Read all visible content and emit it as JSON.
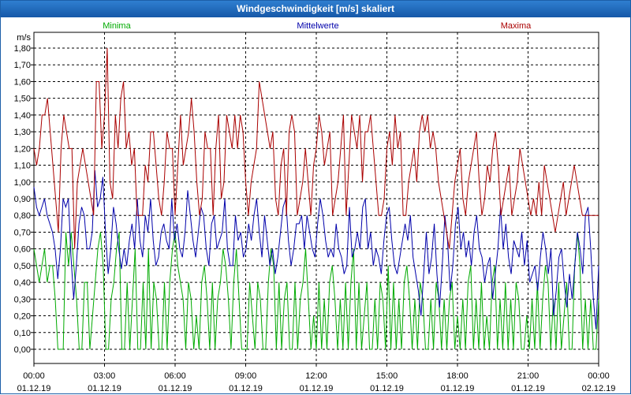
{
  "window": {
    "title": "Windgeschwindigkeit [m/s] skaliert"
  },
  "chart_data": {
    "type": "line",
    "title": "Windgeschwindigkeit [m/s] skaliert",
    "ylabel": "m/s",
    "ylim": [
      0,
      1.8
    ],
    "y_ticks": [
      "0,00",
      "0,10",
      "0,20",
      "0,30",
      "0,40",
      "0,50",
      "0,60",
      "0,70",
      "0,80",
      "0,90",
      "1,00",
      "1,10",
      "1,20",
      "1,30",
      "1,40",
      "1,50",
      "1,60",
      "1,70",
      "1,80"
    ],
    "x_ticks": [
      {
        "time": "00:00",
        "date": "01.12.19"
      },
      {
        "time": "03:00",
        "date": "01.12.19"
      },
      {
        "time": "06:00",
        "date": "01.12.19"
      },
      {
        "time": "09:00",
        "date": "01.12.19"
      },
      {
        "time": "12:00",
        "date": "01.12.19"
      },
      {
        "time": "15:00",
        "date": "01.12.19"
      },
      {
        "time": "18:00",
        "date": "01.12.19"
      },
      {
        "time": "21:00",
        "date": "01.12.19"
      },
      {
        "time": "00:00",
        "date": "02.12.19"
      }
    ],
    "grid": true,
    "legend_position": "top",
    "x_range_hours": [
      0,
      24
    ],
    "series": [
      {
        "name": "Minima",
        "color": "#00aa00",
        "values": [
          0.6,
          0.5,
          0.4,
          0.5,
          0.6,
          0.4,
          0.5,
          0.5,
          0.3,
          0.0,
          0.0,
          0.0,
          0.7,
          0.5,
          0.7,
          0.5,
          0.3,
          0.0,
          0.0,
          0.4,
          0.4,
          0.0,
          0.2,
          0.4,
          0.6,
          0.7,
          0.5,
          0.0,
          0.0,
          0.3,
          0.4,
          0.6,
          0.7,
          0.0,
          0.0,
          0.4,
          0.0,
          0.3,
          0.6,
          0.0,
          0.0,
          0.4,
          0.0,
          0.6,
          0.0,
          0.4,
          0.3,
          0.0,
          0.0,
          0.4,
          0.0,
          0.4,
          0.6,
          0.7,
          0.5,
          0.4,
          0.3,
          0.0,
          0.4,
          0.3,
          0.0,
          0.2,
          0.0,
          0.4,
          0.5,
          0.3,
          0.0,
          0.4,
          0.0,
          0.3,
          0.4,
          0.6,
          0.5,
          0.3,
          0.0,
          0.4,
          0.6,
          0.3,
          0.0,
          0.0,
          0.0,
          0.4,
          0.2,
          0.0,
          0.4,
          0.3,
          0.0,
          0.0,
          0.4,
          0.6,
          0.5,
          0.0,
          0.4,
          0.0,
          0.3,
          0.4,
          0.0,
          0.0,
          0.4,
          0.0,
          0.3,
          0.4,
          0.6,
          0.3,
          0.0,
          0.2,
          0.0,
          0.4,
          0.0,
          0.3,
          0.0,
          0.4,
          0.5,
          0.3,
          0.0,
          0.3,
          0.0,
          0.4,
          0.0,
          0.4,
          0.6,
          0.0,
          0.4,
          0.0,
          0.2,
          0.4,
          0.0,
          0.0,
          0.3,
          0.0,
          0.4,
          0.3,
          0.0,
          0.5,
          0.0,
          0.4,
          0.0,
          0.3,
          0.0,
          0.4,
          0.5,
          0.3,
          0.0,
          0.3,
          0.0,
          0.4,
          0.3,
          0.0,
          0.0,
          0.3,
          0.0,
          0.4,
          0.3,
          0.0,
          0.3,
          0.0,
          0.3,
          0.4,
          0.0,
          0.2,
          0.0,
          0.3,
          0.0,
          0.4,
          0.5,
          0.0,
          0.3,
          0.0,
          0.4,
          0.0,
          0.2,
          0.0,
          0.4,
          0.5,
          0.0,
          0.3,
          0.0,
          0.4,
          0.0,
          0.3,
          0.0,
          0.4,
          0.3,
          0.0,
          0.0,
          0.2,
          0.0,
          0.3,
          0.0,
          0.4,
          0.0,
          0.3,
          0.5,
          0.4,
          0.0,
          0.3,
          0.0,
          0.4,
          0.0,
          0.2,
          0.4,
          0.0,
          0.0,
          0.5,
          0.7,
          0.5,
          0.0,
          0.3,
          0.0,
          0.3,
          0.0,
          0.0,
          0.3
        ]
      },
      {
        "name": "Mittelwerte",
        "color": "#0000aa",
        "values": [
          0.97,
          0.85,
          0.8,
          0.85,
          0.9,
          0.8,
          0.75,
          0.7,
          0.6,
          0.42,
          0.6,
          0.9,
          0.85,
          0.9,
          0.55,
          0.3,
          0.5,
          0.75,
          0.85,
          0.8,
          0.6,
          0.6,
          0.7,
          1.07,
          0.85,
          0.9,
          1.03,
          0.7,
          0.45,
          0.6,
          0.85,
          0.75,
          0.6,
          0.48,
          0.6,
          0.5,
          0.65,
          0.75,
          0.6,
          0.9,
          0.65,
          0.55,
          0.8,
          0.7,
          0.9,
          0.65,
          0.5,
          0.55,
          0.7,
          0.75,
          0.65,
          0.6,
          0.9,
          0.65,
          0.75,
          0.6,
          0.55,
          0.7,
          0.95,
          0.8,
          0.65,
          0.55,
          0.7,
          0.85,
          0.8,
          0.6,
          0.5,
          0.75,
          0.8,
          0.6,
          0.65,
          0.7,
          0.9,
          0.6,
          0.5,
          0.5,
          0.8,
          0.65,
          0.7,
          0.55,
          0.6,
          0.75,
          0.65,
          0.8,
          0.9,
          0.7,
          0.55,
          0.8,
          0.65,
          0.5,
          0.6,
          0.45,
          0.55,
          0.7,
          0.85,
          0.9,
          0.65,
          0.5,
          0.6,
          0.75,
          0.75,
          0.8,
          0.6,
          0.8,
          0.7,
          0.6,
          0.55,
          0.75,
          0.9,
          0.8,
          0.65,
          0.55,
          0.6,
          0.55,
          0.75,
          0.6,
          0.55,
          0.45,
          0.5,
          0.85,
          0.55,
          0.6,
          0.7,
          0.6,
          0.85,
          0.9,
          0.6,
          0.7,
          0.5,
          0.6,
          0.55,
          0.45,
          0.65,
          0.8,
          0.85,
          0.65,
          0.5,
          0.45,
          0.55,
          0.65,
          0.75,
          0.65,
          0.8,
          0.55,
          0.45,
          0.35,
          0.2,
          0.45,
          0.7,
          0.45,
          0.55,
          0.75,
          0.45,
          0.25,
          0.5,
          0.8,
          0.65,
          0.35,
          0.5,
          0.75,
          0.85,
          0.6,
          0.7,
          0.55,
          0.65,
          0.5,
          0.7,
          0.8,
          0.6,
          0.55,
          0.4,
          0.5,
          0.55,
          0.3,
          0.45,
          0.6,
          0.85,
          0.6,
          0.75,
          0.55,
          0.45,
          0.65,
          0.6,
          0.55,
          0.7,
          0.5,
          0.65,
          0.4,
          0.45,
          0.5,
          0.35,
          0.55,
          0.7,
          0.6,
          0.45,
          0.6,
          0.2,
          0.35,
          0.55,
          0.6,
          0.4,
          0.25,
          0.45,
          0.3,
          0.5,
          0.7,
          0.6,
          0.45,
          0.8,
          0.85,
          0.6,
          0.3,
          0.12,
          0.5
        ]
      },
      {
        "name": "Maxima",
        "color": "#aa0000",
        "values": [
          1.2,
          1.1,
          1.2,
          1.4,
          1.4,
          1.5,
          1.3,
          1.1,
          0.9,
          0.7,
          1.2,
          1.4,
          1.3,
          1.2,
          1.2,
          0.6,
          1.0,
          1.1,
          1.2,
          1.1,
          1.0,
          0.9,
          0.8,
          1.6,
          1.6,
          1.2,
          1.4,
          1.8,
          1.0,
          0.9,
          1.4,
          1.2,
          1.5,
          1.6,
          1.2,
          1.3,
          1.1,
          1.2,
          0.8,
          0.8,
          0.8,
          1.1,
          1.0,
          1.3,
          1.3,
          1.1,
          0.9,
          0.8,
          1.0,
          1.3,
          1.2,
          1.2,
          0.8,
          1.1,
          1.4,
          1.1,
          1.2,
          1.3,
          1.5,
          1.3,
          1.0,
          0.8,
          0.9,
          1.3,
          1.2,
          1.2,
          0.8,
          1.2,
          1.4,
          0.9,
          1.0,
          1.4,
          1.3,
          1.2,
          1.4,
          1.2,
          1.4,
          1.3,
          1.0,
          0.8,
          1.0,
          1.1,
          1.2,
          1.6,
          1.5,
          1.4,
          1.3,
          1.2,
          1.3,
          0.9,
          0.8,
          1.1,
          1.2,
          0.8,
          1.3,
          1.4,
          1.3,
          0.8,
          0.9,
          1.0,
          1.2,
          1.0,
          0.8,
          1.1,
          1.2,
          1.4,
          1.3,
          1.1,
          1.2,
          1.3,
          0.8,
          0.9,
          1.0,
          1.2,
          1.4,
          0.8,
          1.1,
          1.4,
          1.3,
          1.2,
          1.4,
          1.0,
          1.3,
          1.3,
          1.4,
          1.2,
          1.0,
          0.8,
          0.8,
          0.9,
          1.2,
          1.3,
          1.1,
          1.4,
          1.2,
          1.3,
          0.8,
          0.8,
          1.0,
          1.1,
          1.2,
          1.0,
          1.3,
          1.4,
          1.3,
          1.4,
          1.2,
          1.3,
          1.2,
          1.0,
          0.9,
          0.8,
          0.7,
          0.6,
          0.8,
          1.0,
          1.1,
          1.2,
          0.9,
          0.8,
          1.0,
          1.1,
          1.2,
          1.3,
          1.0,
          0.8,
          0.9,
          1.1,
          1.0,
          1.2,
          1.3,
          1.1,
          0.8,
          0.9,
          1.0,
          1.1,
          0.8,
          0.9,
          1.0,
          1.2,
          1.1,
          1.0,
          0.9,
          0.8,
          0.9,
          0.8,
          1.0,
          0.8,
          1.1,
          1.0,
          0.9,
          0.8,
          0.7,
          0.8,
          0.9,
          1.0,
          0.8,
          0.9,
          1.0,
          1.1,
          1.0,
          0.9,
          0.8,
          0.8,
          0.8,
          0.8,
          0.8,
          0.8,
          0.8
        ]
      }
    ]
  }
}
